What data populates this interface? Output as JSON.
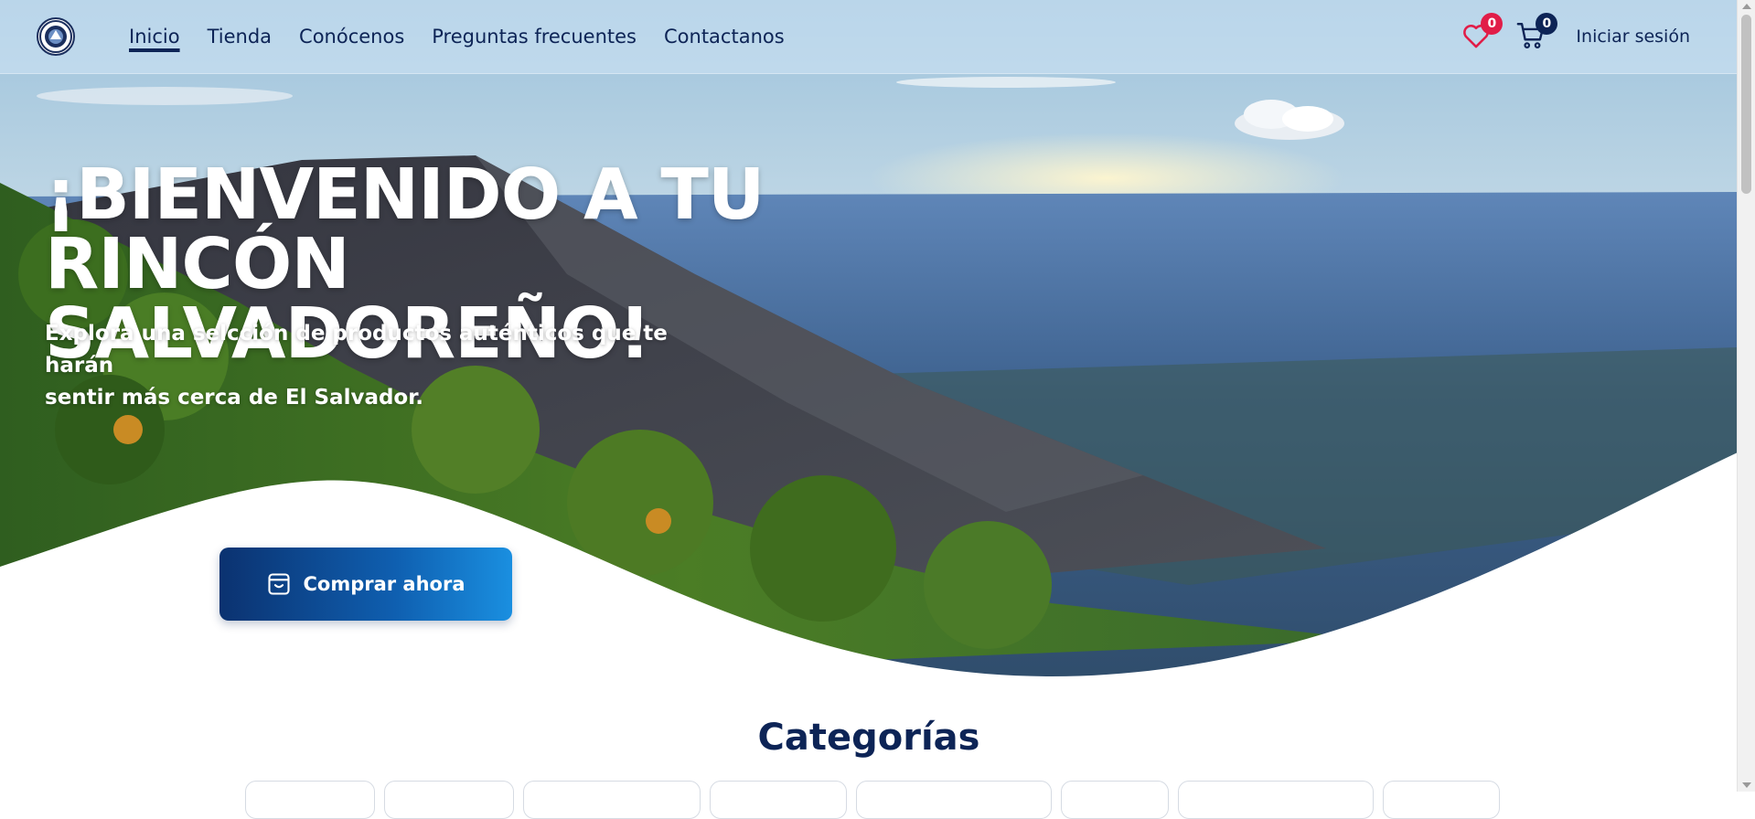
{
  "nav": {
    "links": [
      "Inicio",
      "Tienda",
      "Conócenos",
      "Preguntas frecuentes",
      "Contactanos"
    ],
    "active_index": 0,
    "wishlist_icon": "heart-icon",
    "wishlist_count": "0",
    "cart_icon": "cart-icon",
    "cart_count": "0",
    "login_label": "Iniciar sesión"
  },
  "hero": {
    "title_line1": "¡BIENVENIDO A TU",
    "title_line2": "RINCÓN SALVADOREÑO!",
    "subtitle_line1": "Explora una selcción de productos auténticos que te harán",
    "subtitle_line2": "sentir más cerca de El Salvador.",
    "cta_label": "Comprar ahora",
    "cta_icon": "store-icon"
  },
  "categories": {
    "title": "Categorías"
  },
  "colors": {
    "navy": "#0d2456",
    "badge_red": "#e11d48",
    "cta_start": "#0b3270",
    "cta_end": "#1a8fe0"
  }
}
